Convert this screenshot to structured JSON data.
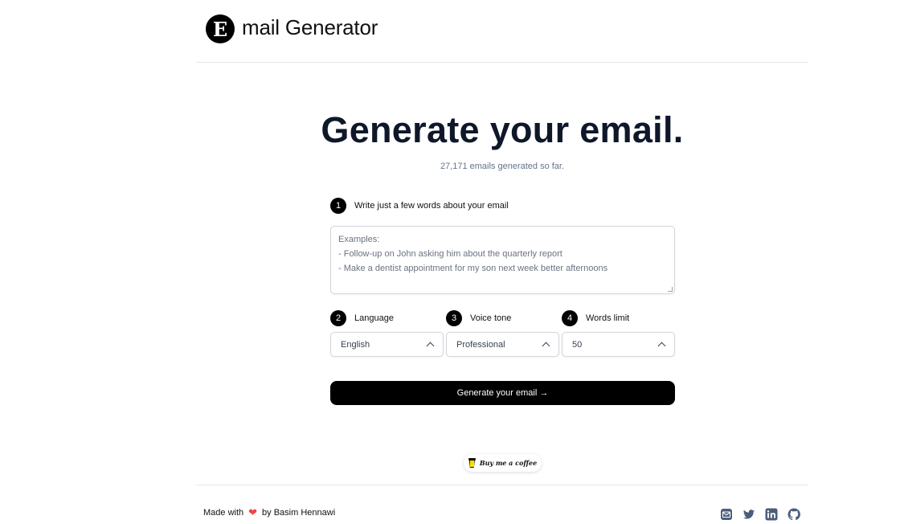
{
  "header": {
    "logo_letter": "E",
    "brand": "mail Generator"
  },
  "hero": {
    "title": "Generate your email.",
    "counter": "27,171 emails generated so far."
  },
  "form": {
    "step1": {
      "number": "1",
      "label": "Write just a few words about your email"
    },
    "description": {
      "value": "",
      "placeholder_lines": [
        "Examples:",
        "- Follow-up on John asking him about the quarterly report",
        "- Make a dentist appointment for my son next week better afternoons"
      ]
    },
    "step2": {
      "number": "2",
      "label": "Language",
      "selected": "English"
    },
    "step3": {
      "number": "3",
      "label": "Voice tone",
      "selected": "Professional"
    },
    "step4": {
      "number": "4",
      "label": "Words limit",
      "selected": "50"
    },
    "generate_label": "Generate your email →"
  },
  "coffee": {
    "label": "Buy me a coffee"
  },
  "footer": {
    "made_with": "Made with",
    "heart": "❤",
    "by": "by Basim Hennawi",
    "social_icons": [
      "email-icon",
      "twitter-icon",
      "linkedin-icon",
      "github-icon"
    ]
  },
  "colors": {
    "accent": "#000000",
    "muted_text": "#64748b",
    "social_icon": "#4b5d7a",
    "heart": "#ef4444"
  }
}
